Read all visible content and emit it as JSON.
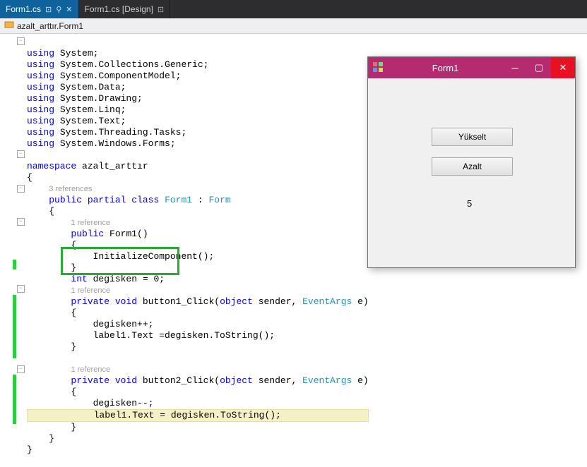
{
  "tabs": [
    {
      "label": "Form1.cs"
    },
    {
      "label": "Form1.cs [Design]"
    }
  ],
  "breadcrumb": {
    "text": "azalt_arttır.Form1"
  },
  "code": {
    "l1": "using",
    "ns1": " System;",
    "ns2": " System.Collections.Generic;",
    "ns3": " System.ComponentModel;",
    "ns4": " System.Data;",
    "ns5": " System.Drawing;",
    "ns6": " System.Linq;",
    "ns7": " System.Text;",
    "ns8": " System.Threading.Tasks;",
    "ns9": " System.Windows.Forms;",
    "nsKw": "namespace",
    "nsName": " azalt_arttır",
    "refs3": "3 references",
    "pub": "public",
    "partial": " partial",
    "classKw": " class",
    "form1": " Form1",
    "colon": " : ",
    "formBase": "Form",
    "ref1a": "1 reference",
    "ctor": " Form1()",
    "initComp": "InitializeComponent();",
    "intKw": "int",
    "degisken": " degisken = 0;",
    "ref1b": "1 reference",
    "priv": "private",
    "voidKw": " void",
    "btn1click": " button1_Click(",
    "objKw": "object",
    "sender": " sender, ",
    "evArgs": "EventArgs",
    "eParam": " e)",
    "inc": "degisken++;",
    "assign1": "label1.Text =degisken.ToString();",
    "ref1c": "1 reference",
    "btn2click": " button2_Click(",
    "dec": "degisken--;",
    "assign2": "label1.Text = degisken.ToString();"
  },
  "winform": {
    "title": "Form1",
    "btn1": "Yükselt",
    "btn2": "Azalt",
    "label": "5"
  }
}
